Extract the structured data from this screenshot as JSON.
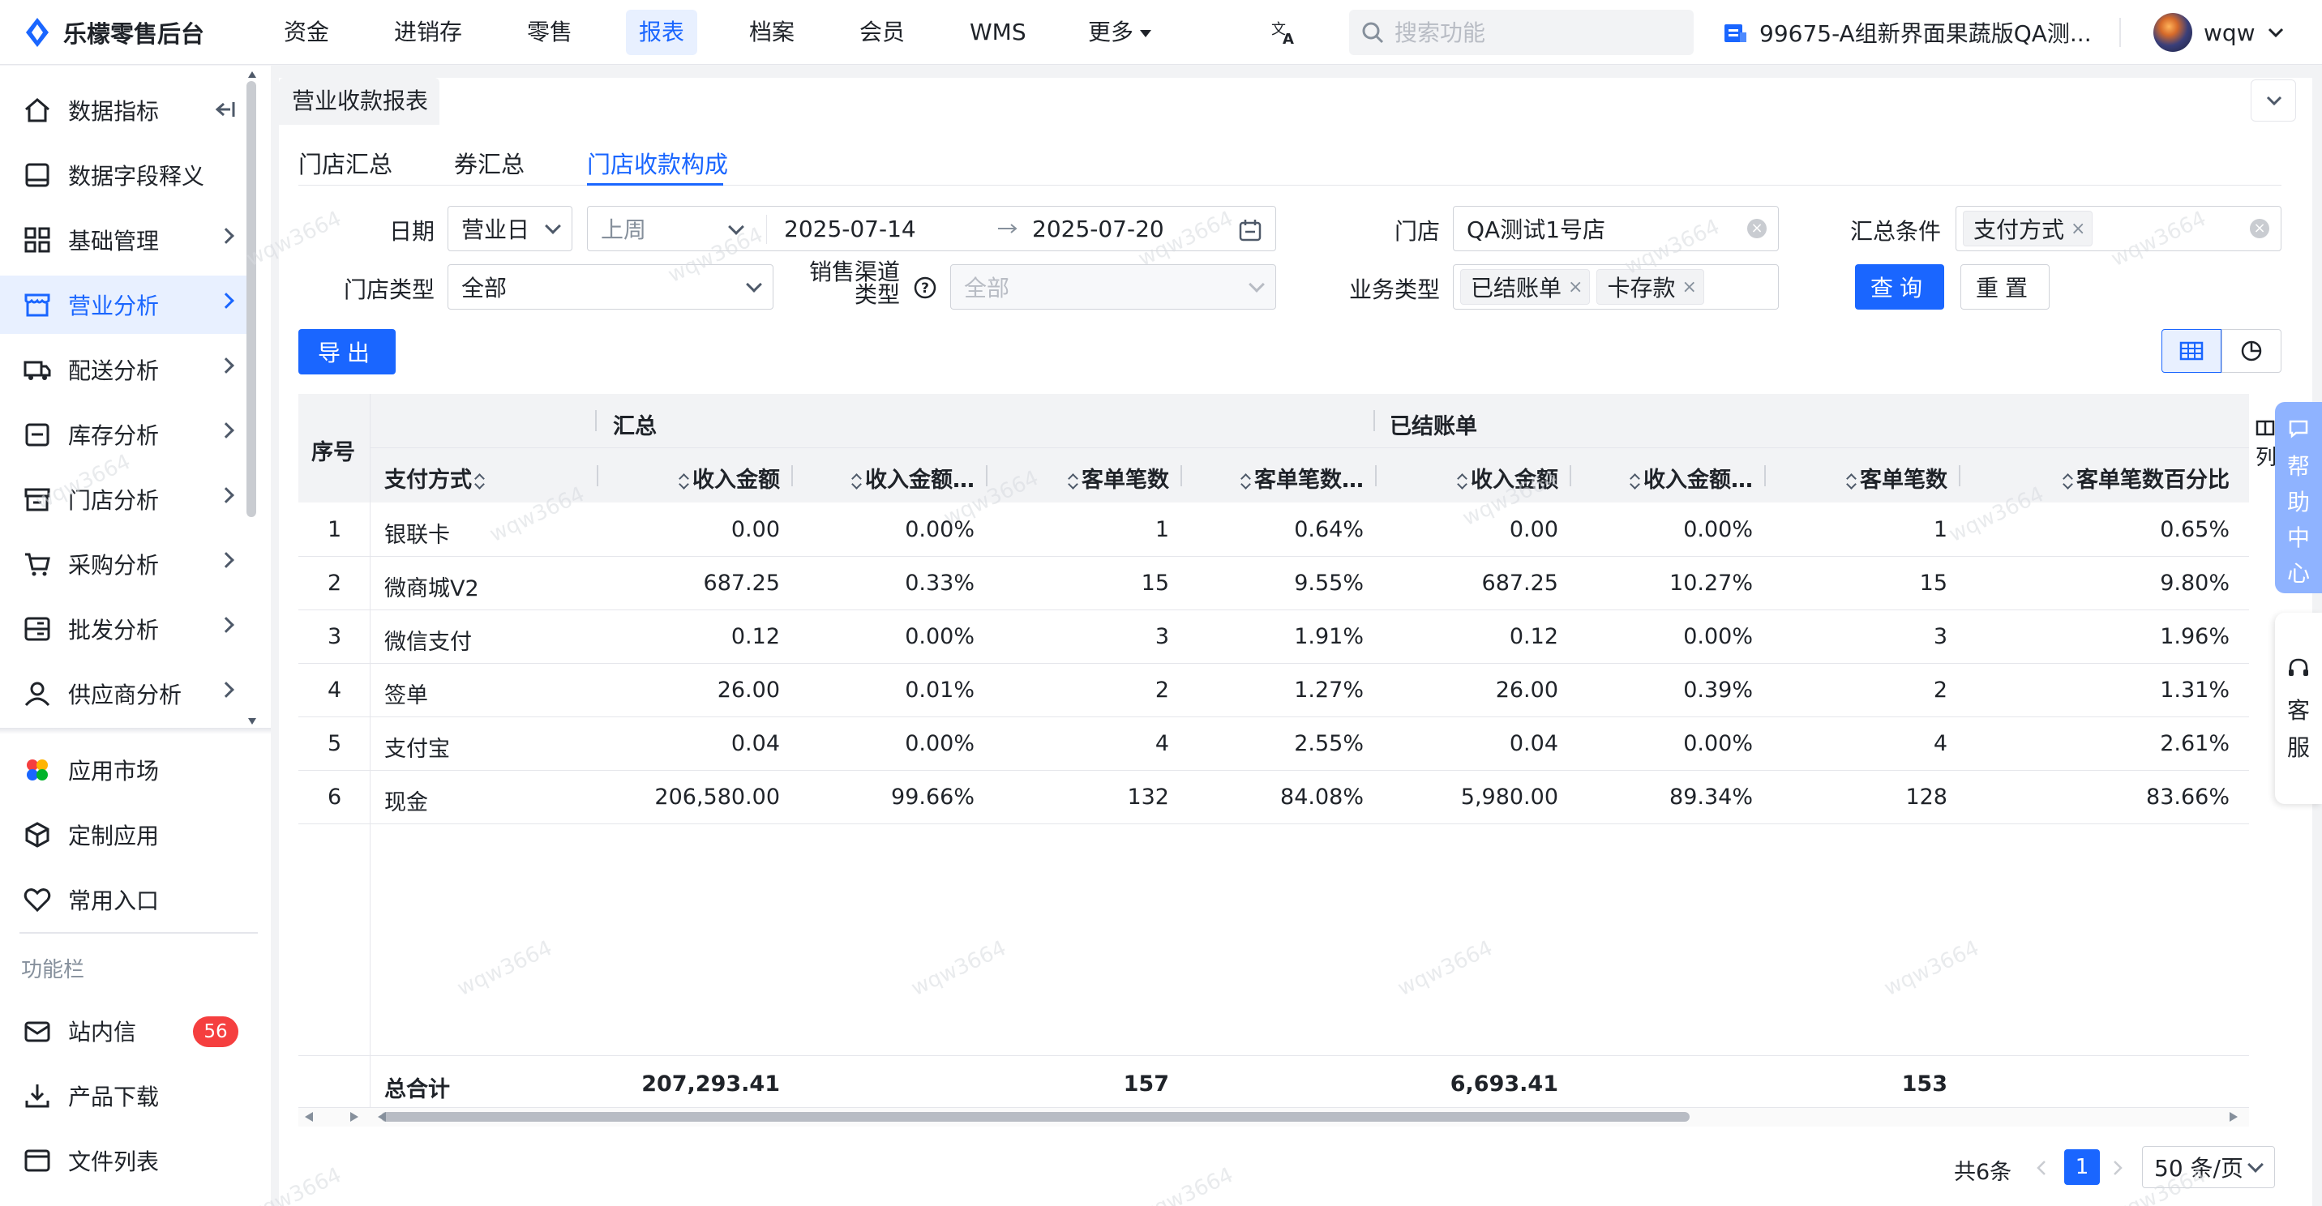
{
  "app": {
    "name": "乐檬零售后台"
  },
  "topnav": {
    "items": [
      "资金",
      "进销存",
      "零售",
      "报表",
      "档案",
      "会员",
      "WMS"
    ],
    "more": "更多",
    "active": "报表"
  },
  "search": {
    "placeholder": "搜索功能"
  },
  "store_name": "99675-A组新界面果蔬版QA测...",
  "user": {
    "name": "wqw"
  },
  "sidebar": {
    "items": [
      "数据指标",
      "数据字段释义",
      "基础管理",
      "营业分析",
      "配送分析",
      "库存分析",
      "门店分析",
      "采购分析",
      "批发分析",
      "供应商分析"
    ],
    "active": "营业分析",
    "apps": [
      "应用市场",
      "定制应用",
      "常用入口"
    ],
    "section_label": "功能栏",
    "tools": [
      "站内信",
      "产品下载",
      "文件列表"
    ],
    "badge_count": "56"
  },
  "page_tab": "营业收款报表",
  "subtabs": [
    "门店汇总",
    "券汇总",
    "门店收款构成"
  ],
  "active_subtab": "门店收款构成",
  "filters": {
    "date_label": "日期",
    "date_type": "营业日",
    "date_preset": "上周",
    "date_start": "2025-07-14",
    "date_end": "2025-07-20",
    "store_label": "门店",
    "store_value": "QA测试1号店",
    "summary_label": "汇总条件",
    "summary_tag": "支付方式",
    "store_type_label": "门店类型",
    "store_type_value": "全部",
    "channel_label_1": "销售渠道",
    "channel_label_2": "类型",
    "channel_value": "全部",
    "biz_type_label": "业务类型",
    "biz_tags": [
      "已结账单",
      "卡存款"
    ],
    "query_btn": "查询",
    "reset_btn": "重置",
    "export_btn": "导出"
  },
  "table": {
    "group_headers": [
      "汇总",
      "已结账单"
    ],
    "seq_header": "序号",
    "col_method": "支付方式",
    "cols": [
      "收入金额",
      "收入金额…",
      "客单笔数",
      "客单笔数…",
      "收入金额",
      "收入金额…",
      "客单笔数",
      "客单笔数百分比"
    ],
    "col_setting": "列",
    "rows": [
      {
        "seq": "1",
        "method": "银联卡",
        "v": [
          "0.00",
          "0.00%",
          "1",
          "0.64%",
          "0.00",
          "0.00%",
          "1",
          "0.65%"
        ]
      },
      {
        "seq": "2",
        "method": "微商城V2",
        "v": [
          "687.25",
          "0.33%",
          "15",
          "9.55%",
          "687.25",
          "10.27%",
          "15",
          "9.80%"
        ]
      },
      {
        "seq": "3",
        "method": "微信支付",
        "v": [
          "0.12",
          "0.00%",
          "3",
          "1.91%",
          "0.12",
          "0.00%",
          "3",
          "1.96%"
        ]
      },
      {
        "seq": "4",
        "method": "签单",
        "v": [
          "26.00",
          "0.01%",
          "2",
          "1.27%",
          "26.00",
          "0.39%",
          "2",
          "1.31%"
        ]
      },
      {
        "seq": "5",
        "method": "支付宝",
        "v": [
          "0.04",
          "0.00%",
          "4",
          "2.55%",
          "0.04",
          "0.00%",
          "4",
          "2.61%"
        ]
      },
      {
        "seq": "6",
        "method": "现金",
        "v": [
          "206,580.00",
          "99.66%",
          "132",
          "84.08%",
          "5,980.00",
          "89.34%",
          "128",
          "83.66%"
        ]
      }
    ],
    "total_label": "总合计",
    "totals": [
      "207,293.41",
      "",
      "157",
      "",
      "6,693.41",
      "",
      "153",
      ""
    ]
  },
  "help": {
    "chars": [
      "帮",
      "助",
      "中",
      "心"
    ]
  },
  "service": {
    "chars": [
      "客",
      "服"
    ]
  },
  "pagination": {
    "total": "共6条",
    "page": "1",
    "size": "50 条/页"
  },
  "watermark": "wqw3664",
  "colors": {
    "accent": "#1a66ff",
    "danger": "#f53f3f"
  }
}
